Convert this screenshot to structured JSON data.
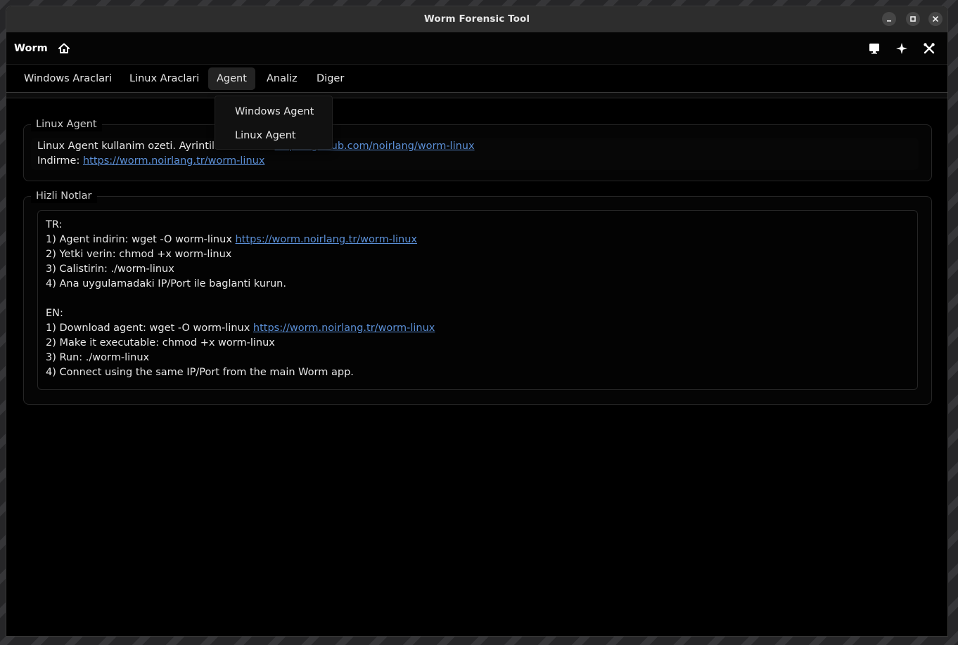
{
  "window": {
    "title": "Worm Forensic Tool",
    "controls": [
      "minimize-icon",
      "maximize-icon",
      "close-icon"
    ]
  },
  "header": {
    "app_title": "Worm",
    "left_icon": "home-icon",
    "right_icons": [
      "monitor-icon",
      "sparkle-icon",
      "tools-icon"
    ]
  },
  "menu": {
    "items": [
      {
        "label": "Windows Araclari"
      },
      {
        "label": "Linux Araclari"
      },
      {
        "label": "Agent",
        "active": true
      },
      {
        "label": "Analiz"
      },
      {
        "label": "Diger"
      }
    ],
    "dropdown": {
      "items": [
        {
          "label": "Windows Agent"
        },
        {
          "label": "Linux Agent"
        }
      ]
    }
  },
  "linux_agent_box": {
    "title": "Linux Agent",
    "line1_text": "Linux Agent kullanim ozeti. Ayrintili dokuman: ",
    "line1_link": "https://github.com/noirlang/worm-linux",
    "line2_text": "Indirme: ",
    "line2_link": "https://worm.noirlang.tr/worm-linux"
  },
  "notes_box": {
    "title": "Hizli Notlar",
    "tr_header": "TR:",
    "tr_1_text": "1) Agent indirin: wget -O worm-linux ",
    "tr_1_link": "https://worm.noirlang.tr/worm-linux",
    "tr_2": "2) Yetki verin: chmod +x worm-linux",
    "tr_3": "3) Calistirin: ./worm-linux",
    "tr_4": "4) Ana uygulamadaki IP/Port ile baglanti kurun.",
    "en_header": "EN:",
    "en_1_text": "1) Download agent: wget -O worm-linux ",
    "en_1_link": "https://worm.noirlang.tr/worm-linux",
    "en_2": "2) Make it executable: chmod +x worm-linux",
    "en_3": "3) Run: ./worm-linux",
    "en_4": "4) Connect using the same IP/Port from the main Worm app."
  },
  "colors": {
    "background": "#000000",
    "titlebar": "#2d2d2d",
    "text": "#e8e8e8",
    "link": "#5b8fd6",
    "menu_active": "#232323",
    "dropdown_bg": "#111111"
  }
}
